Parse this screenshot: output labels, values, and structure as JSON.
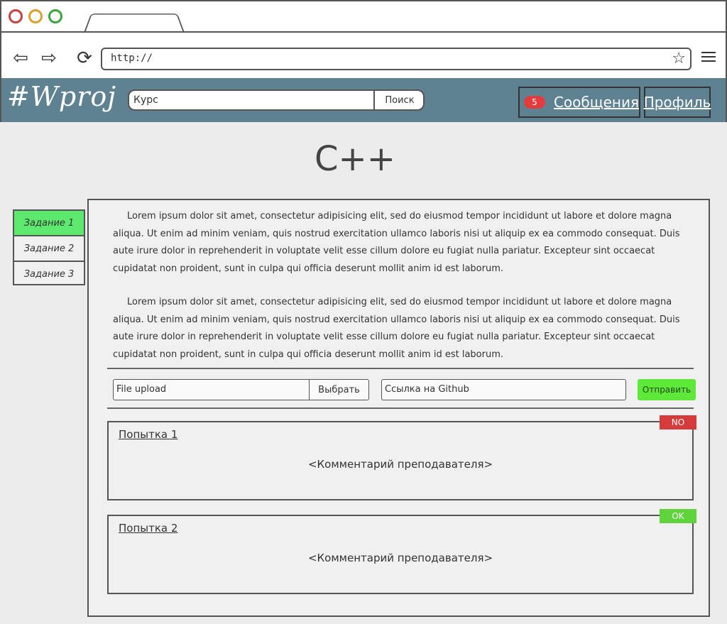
{
  "browser": {
    "url": "http://"
  },
  "header": {
    "logo": "#Wproj",
    "search_placeholder": "Курс",
    "search_button": "Поиск",
    "messages_count": "5",
    "messages_label": "Сообщения",
    "profile_label": "Профиль"
  },
  "page": {
    "title": "C++"
  },
  "sidebar": {
    "items": [
      {
        "label": "Задание 1",
        "active": true
      },
      {
        "label": "Задание 2",
        "active": false
      },
      {
        "label": "Задание 3",
        "active": false
      }
    ]
  },
  "task": {
    "paragraphs": [
      "Lorem ipsum dolor sit amet, consectetur adipisicing elit, sed do eiusmod tempor incididunt ut labore et dolore magna aliqua. Ut enim ad minim veniam, quis nostrud exercitation ullamco laboris nisi ut aliquip ex ea commodo consequat. Duis aute irure dolor in reprehenderit in voluptate velit esse cillum dolore eu fugiat nulla pariatur. Excepteur sint occaecat cupidatat non proident, sunt in culpa qui officia deserunt mollit anim id est laborum.",
      "Lorem ipsum dolor sit amet, consectetur adipisicing elit, sed do eiusmod tempor incididunt ut labore et dolore magna aliqua. Ut enim ad minim veniam, quis nostrud exercitation ullamco laboris nisi ut aliquip ex ea commodo consequat. Duis aute irure dolor in reprehenderit in voluptate velit esse cillum dolore eu fugiat nulla pariatur. Excepteur sint occaecat cupidatat non proident, sunt in culpa qui officia deserunt mollit anim id est laborum."
    ]
  },
  "submission": {
    "file_upload_placeholder": "File upload",
    "choose_button": "Выбрать",
    "github_placeholder": "Ссылка на Github",
    "send_button": "Отправить"
  },
  "attempts": [
    {
      "title": "Попытка 1",
      "comment": "<Комментарий преподавателя>",
      "status": "NO"
    },
    {
      "title": "Попытка 2",
      "comment": "<Комментарий преподавателя>",
      "status": "OK"
    }
  ],
  "colors": {
    "header_bg": "#5e8291",
    "active_green": "#5de86e",
    "status_no": "#d63b3b",
    "status_ok": "#5ed33c",
    "badge_red": "#e33c3c"
  }
}
